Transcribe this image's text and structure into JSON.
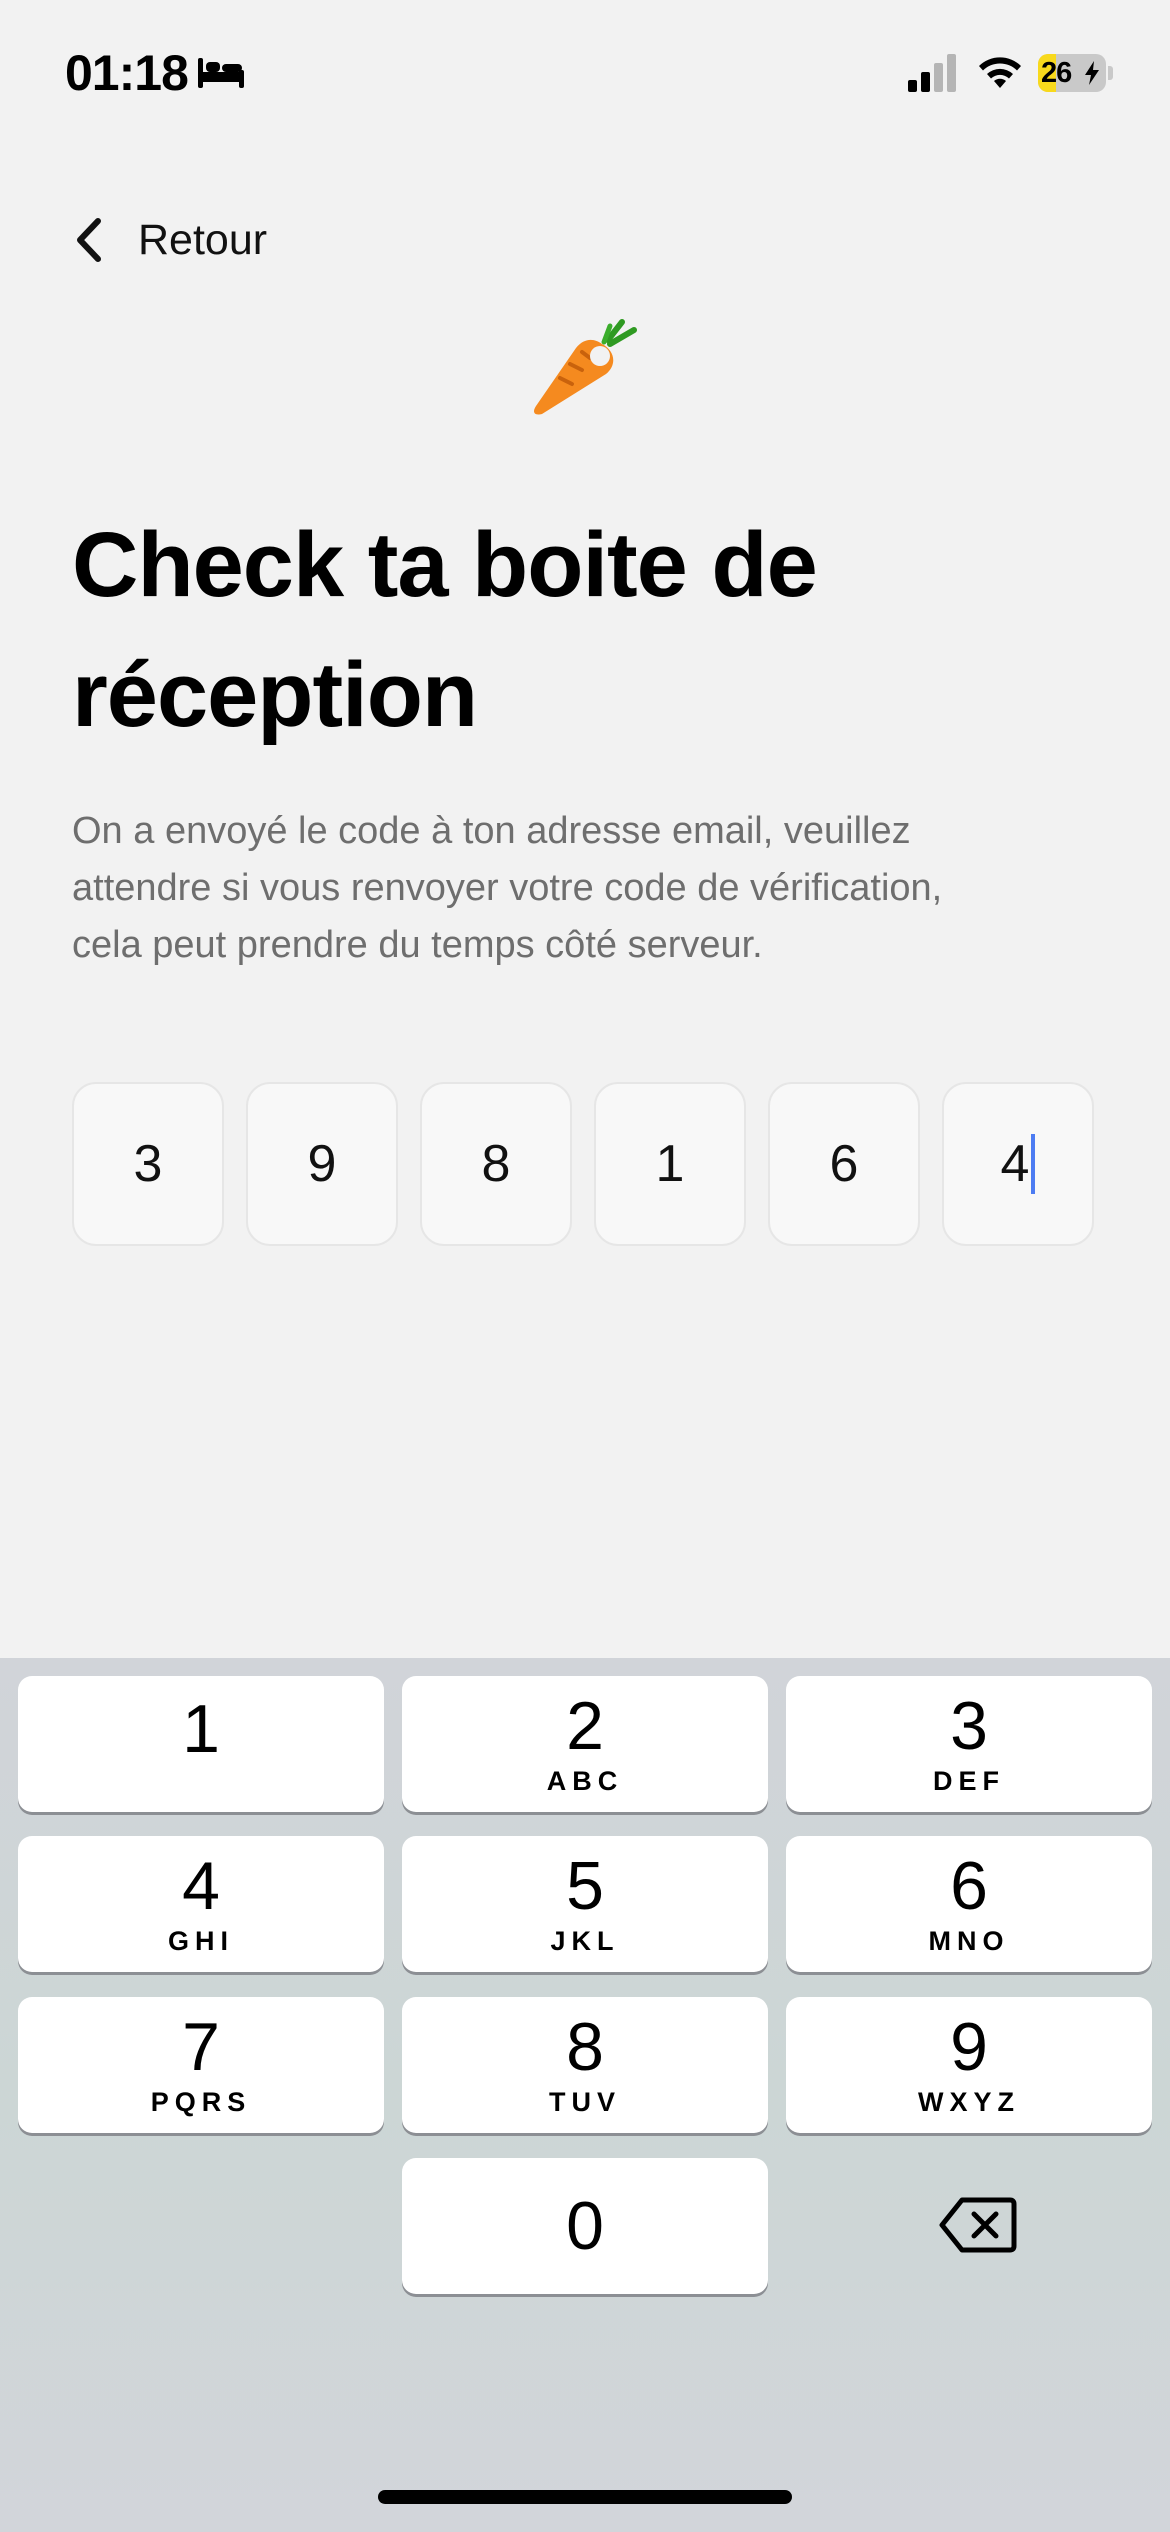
{
  "status_bar": {
    "time": "01:18",
    "battery": "26",
    "battery_level": 0.26,
    "icons": [
      "bed-icon",
      "signal-icon",
      "wifi-icon",
      "battery-icon"
    ]
  },
  "nav": {
    "back_label": "Retour",
    "back_icon": "chevron-left-icon"
  },
  "header_icon": "carrot-icon",
  "title": "Check ta boite de réception",
  "description": "On a envoyé le code à ton adresse email, veuillez attendre si vous renvoyer votre code de vérification, cela peut prendre du temps côté serveur.",
  "code_digits": [
    "3",
    "9",
    "8",
    "1",
    "6",
    "4"
  ],
  "keyboard": {
    "keys": [
      {
        "digit": "1",
        "letters": ""
      },
      {
        "digit": "2",
        "letters": "ABC"
      },
      {
        "digit": "3",
        "letters": "DEF"
      },
      {
        "digit": "4",
        "letters": "GHI"
      },
      {
        "digit": "5",
        "letters": "JKL"
      },
      {
        "digit": "6",
        "letters": "MNO"
      },
      {
        "digit": "7",
        "letters": "PQRS"
      },
      {
        "digit": "8",
        "letters": "TUV"
      },
      {
        "digit": "9",
        "letters": "WXYZ"
      },
      {
        "digit": "0",
        "letters": ""
      }
    ],
    "delete_icon": "delete-backspace-icon"
  }
}
